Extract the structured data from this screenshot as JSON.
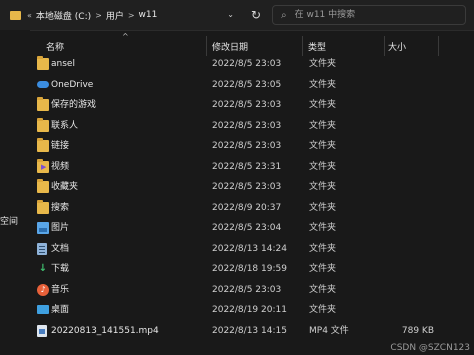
{
  "address": {
    "segments": [
      "本地磁盘 (C:)",
      "用户",
      "w11"
    ],
    "separator": ">"
  },
  "search": {
    "placeholder": "在 w11 中搜索"
  },
  "sidebar": {
    "partial_label": "空间"
  },
  "columns": {
    "name": "名称",
    "date": "修改日期",
    "type": "类型",
    "size": "大小"
  },
  "rows": [
    {
      "name": "ansel",
      "date": "2022/8/5 23:03",
      "type": "文件夹",
      "size": "",
      "icon": "folder-icon"
    },
    {
      "name": "OneDrive",
      "date": "2022/8/5 23:05",
      "type": "文件夹",
      "size": "",
      "icon": "cloud-icon"
    },
    {
      "name": "保存的游戏",
      "date": "2022/8/5 23:03",
      "type": "文件夹",
      "size": "",
      "icon": "folder-icon"
    },
    {
      "name": "联系人",
      "date": "2022/8/5 23:03",
      "type": "文件夹",
      "size": "",
      "icon": "folder-icon"
    },
    {
      "name": "链接",
      "date": "2022/8/5 23:03",
      "type": "文件夹",
      "size": "",
      "icon": "folder-icon"
    },
    {
      "name": "视频",
      "date": "2022/8/5 23:31",
      "type": "文件夹",
      "size": "",
      "icon": "video-icon"
    },
    {
      "name": "收藏夹",
      "date": "2022/8/5 23:03",
      "type": "文件夹",
      "size": "",
      "icon": "folder-icon"
    },
    {
      "name": "搜索",
      "date": "2022/8/9 20:37",
      "type": "文件夹",
      "size": "",
      "icon": "folder-icon"
    },
    {
      "name": "图片",
      "date": "2022/8/5 23:04",
      "type": "文件夹",
      "size": "",
      "icon": "picture-icon"
    },
    {
      "name": "文档",
      "date": "2022/8/13 14:24",
      "type": "文件夹",
      "size": "",
      "icon": "document-icon"
    },
    {
      "name": "下载",
      "date": "2022/8/18 19:59",
      "type": "文件夹",
      "size": "",
      "icon": "download-icon"
    },
    {
      "name": "音乐",
      "date": "2022/8/5 23:03",
      "type": "文件夹",
      "size": "",
      "icon": "music-icon"
    },
    {
      "name": "桌面",
      "date": "2022/8/19 20:11",
      "type": "文件夹",
      "size": "",
      "icon": "desktop-icon"
    },
    {
      "name": "20220813_141551.mp4",
      "date": "2022/8/13 14:15",
      "type": "MP4 文件",
      "size": "789 KB",
      "icon": "mp4-file-icon"
    }
  ],
  "watermark": "CSDN @SZCN123",
  "colors": {
    "folder": "#e8b84a",
    "onedrive": "#3b8de0",
    "download": "#3fbf6f",
    "music": "#e8613a",
    "picture": "#5aa6e8"
  }
}
